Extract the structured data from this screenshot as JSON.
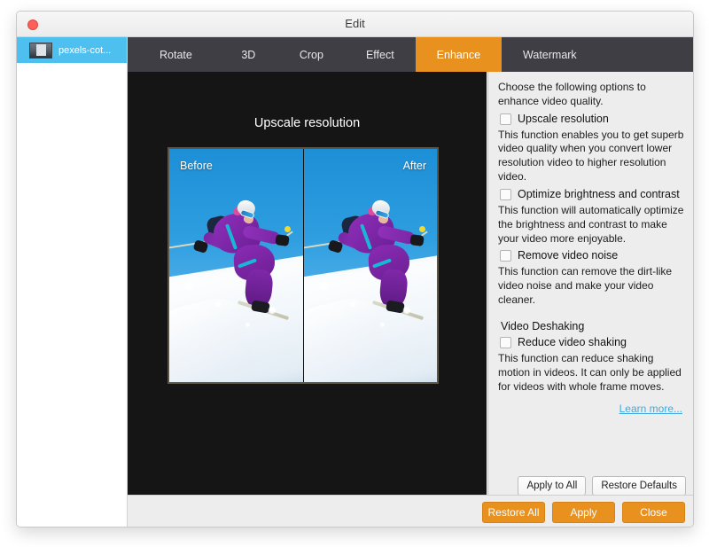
{
  "window": {
    "title": "Edit",
    "close_button_label": "close"
  },
  "sidebar": {
    "items": [
      {
        "label": "pexels-cot...",
        "thumb_icon": "video-thumbnail"
      }
    ]
  },
  "tabs": [
    {
      "label": "Rotate",
      "active": false
    },
    {
      "label": "3D",
      "active": false
    },
    {
      "label": "Crop",
      "active": false
    },
    {
      "label": "Effect",
      "active": false
    },
    {
      "label": "Enhance",
      "active": true
    },
    {
      "label": "Watermark",
      "active": false
    }
  ],
  "canvas": {
    "title": "Upscale resolution",
    "before_label": "Before",
    "after_label": "After"
  },
  "options_panel": {
    "intro": "Choose the following options to enhance video quality.",
    "items": [
      {
        "checkbox_label": "Upscale resolution",
        "checked": false,
        "description": "This function enables you to get superb video quality when you convert lower resolution video to higher resolution video."
      },
      {
        "checkbox_label": "Optimize brightness and contrast",
        "checked": false,
        "description": "This function will automatically optimize the brightness and contrast to make your video more enjoyable."
      },
      {
        "checkbox_label": "Remove video noise",
        "checked": false,
        "description": "This function can remove the dirt-like video noise and make your video cleaner."
      }
    ],
    "group_title": "Video Deshaking",
    "deshaking": {
      "checkbox_label": "Reduce video shaking",
      "checked": false,
      "description": "This function can reduce shaking motion in videos. It can only be applied for videos with whole frame moves."
    },
    "learn_more": "Learn more...",
    "apply_to_all": "Apply to All",
    "restore_defaults": "Restore Defaults"
  },
  "footer": {
    "restore_all": "Restore All",
    "apply": "Apply",
    "close": "Close"
  },
  "colors": {
    "accent_orange": "#e8911f",
    "tabbar": "#3e3e44",
    "canvas": "#151516",
    "panel": "#ededed",
    "selection_blue": "#4ec0f0",
    "link_blue": "#3fa9e0"
  }
}
